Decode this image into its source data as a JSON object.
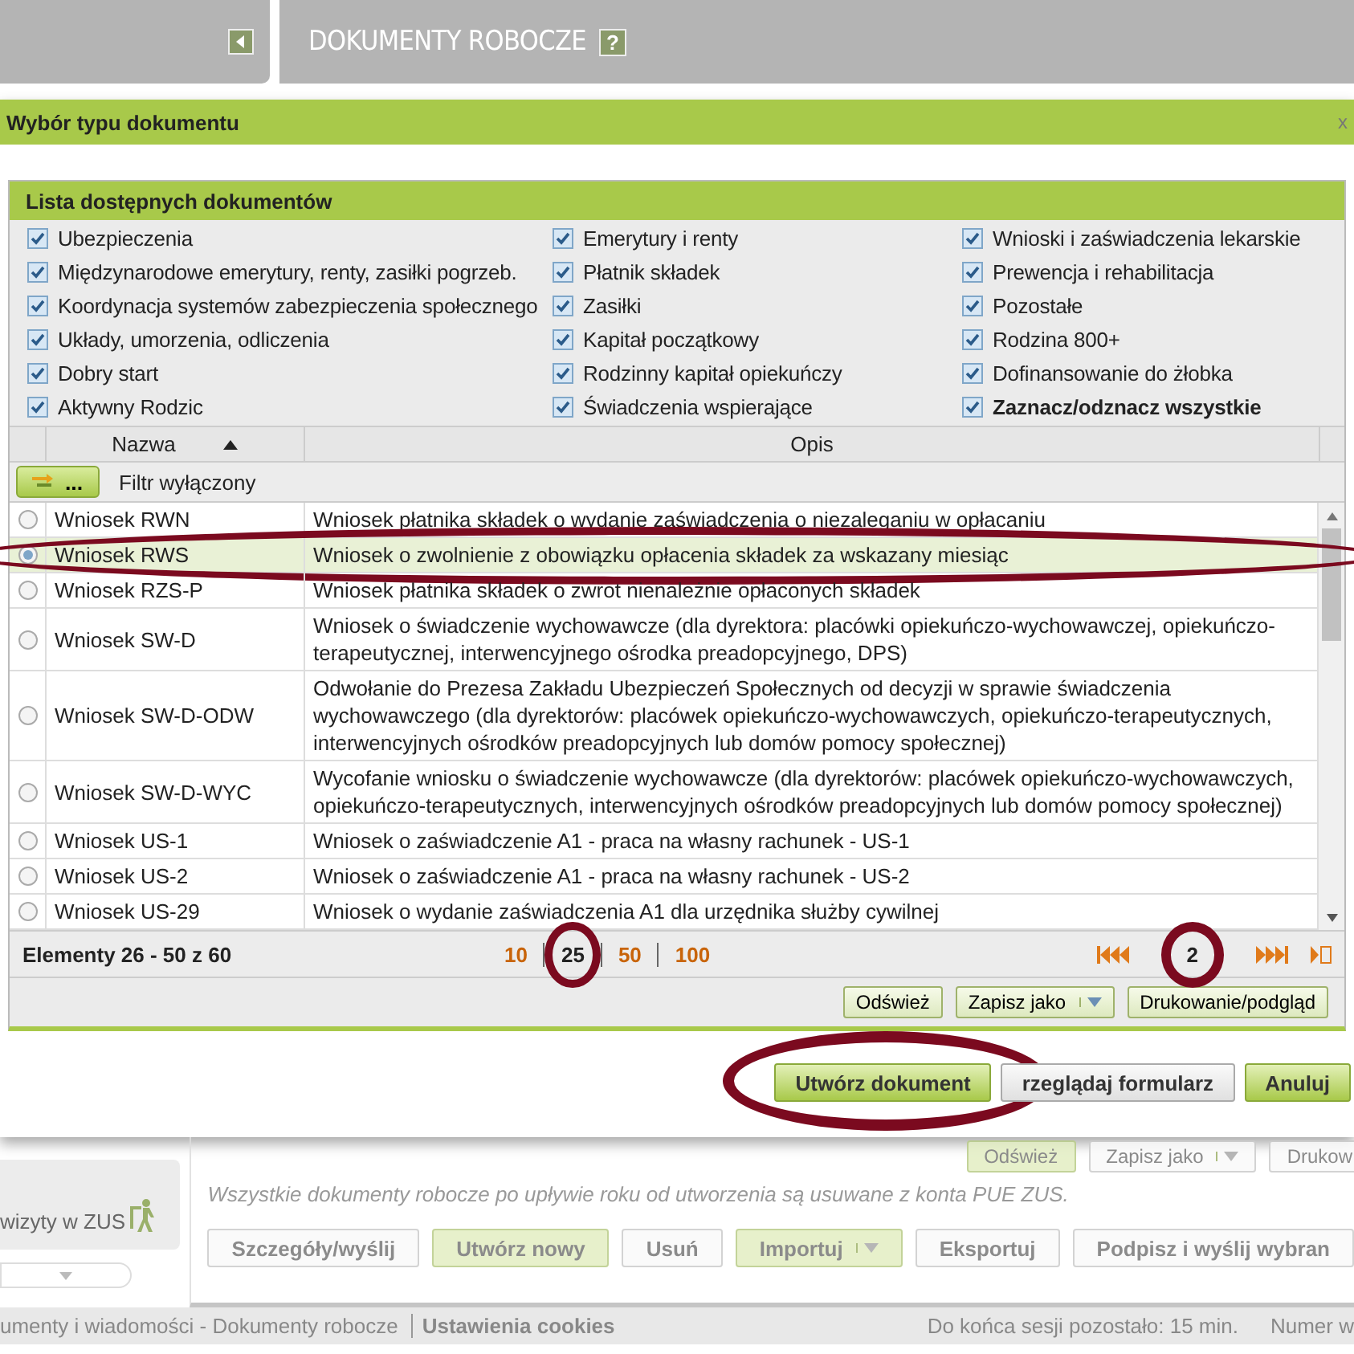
{
  "header": {
    "title": "DOKUMENTY ROBOCZE",
    "help": "?"
  },
  "dialog": {
    "title": "Wybór typu dokumentu",
    "close": "x",
    "panel_title": "Lista dostępnych dokumentów",
    "categories": [
      {
        "label": "Ubezpieczenia",
        "checked": true,
        "kind": "category"
      },
      {
        "label": "Emerytury i renty",
        "checked": true,
        "kind": "category"
      },
      {
        "label": "Wnioski i zaświadczenia lekarskie",
        "checked": true,
        "kind": "category"
      },
      {
        "label": "Międzynarodowe emerytury, renty, zasiłki pogrzeb.",
        "checked": true,
        "kind": "category"
      },
      {
        "label": "Płatnik składek",
        "checked": true,
        "kind": "category"
      },
      {
        "label": "Prewencja i rehabilitacja",
        "checked": true,
        "kind": "category"
      },
      {
        "label": "Koordynacja systemów zabezpieczenia społecznego",
        "checked": true,
        "kind": "category"
      },
      {
        "label": "Zasiłki",
        "checked": true,
        "kind": "category"
      },
      {
        "label": "Pozostałe",
        "checked": true,
        "kind": "category"
      },
      {
        "label": "Układy, umorzenia, odliczenia",
        "checked": true,
        "kind": "category"
      },
      {
        "label": "Kapitał początkowy",
        "checked": true,
        "kind": "category"
      },
      {
        "label": "Rodzina 800+",
        "checked": true,
        "kind": "category"
      },
      {
        "label": "Dobry start",
        "checked": true,
        "kind": "category"
      },
      {
        "label": "Rodzinny kapitał opiekuńczy",
        "checked": true,
        "kind": "category"
      },
      {
        "label": "Dofinansowanie do żłobka",
        "checked": true,
        "kind": "category"
      },
      {
        "label": "Aktywny Rodzic",
        "checked": true,
        "kind": "category"
      },
      {
        "label": "Świadczenia wspierające",
        "checked": true,
        "kind": "category"
      },
      {
        "label": "Zaznacz/odznacz wszystkie",
        "checked": true,
        "kind": "toggle_all"
      }
    ],
    "table": {
      "columns": [
        {
          "label": "Nazwa",
          "sorted": true
        },
        {
          "label": "Opis"
        }
      ],
      "filter": {
        "button": "...",
        "label": "Filtr wyłączony"
      },
      "rows": [
        {
          "name": "Wniosek RWN",
          "description": "Wniosek płatnika składek o wydanie zaświadczenia o niezaleganiu w opłacaniu",
          "selected": false,
          "highlighted": false
        },
        {
          "name": "Wniosek RWS",
          "description": "Wniosek o zwolnienie z obowiązku opłacenia składek za wskazany miesiąc",
          "selected": true,
          "highlighted": true
        },
        {
          "name": "Wniosek RZS-P",
          "description": "Wniosek płatnika składek o zwrot nienależnie opłaconych składek",
          "selected": false,
          "highlighted": false
        },
        {
          "name": "Wniosek SW-D",
          "description": "Wniosek o świadczenie wychowawcze (dla dyrektora: placówki opiekuńczo-wychowawczej, opiekuńczo-terapeutycznej, interwencyjnego ośrodka preadopcyjnego, DPS)",
          "selected": false,
          "highlighted": false
        },
        {
          "name": "Wniosek SW-D-ODW",
          "description": "Odwołanie do Prezesa Zakładu Ubezpieczeń Społecznych od decyzji w sprawie świadczenia wychowawczego (dla dyrektorów: placówek opiekuńczo-wychowawczych, opiekuńczo-terapeutycznych, interwencyjnych ośrodków preadopcyjnych lub domów pomocy społecznej)",
          "selected": false,
          "highlighted": false
        },
        {
          "name": "Wniosek SW-D-WYC",
          "description": "Wycofanie wniosku o świadczenie wychowawcze (dla dyrektorów: placówek opiekuńczo-wychowawczych, opiekuńczo-terapeutycznych, interwencyjnych ośrodków preadopcyjnych lub domów pomocy społecznej)",
          "selected": false,
          "highlighted": false
        },
        {
          "name": "Wniosek US-1",
          "description": "Wniosek o zaświadczenie A1 - praca na własny rachunek - US-1",
          "selected": false,
          "highlighted": false
        },
        {
          "name": "Wniosek US-2",
          "description": "Wniosek o zaświadczenie A1 - praca na własny rachunek - US-2",
          "selected": false,
          "highlighted": false
        },
        {
          "name": "Wniosek US-29",
          "description": "Wniosek o wydanie zaświadczenia A1 dla urzędnika służby cywilnej",
          "selected": false,
          "highlighted": false
        }
      ]
    },
    "pager": {
      "summary": "Elementy 26 - 50 z 60",
      "page_sizes": [
        {
          "label": "10",
          "selected": false,
          "highlighted": false
        },
        {
          "label": "25",
          "selected": true,
          "highlighted": true
        },
        {
          "label": "50",
          "selected": false,
          "highlighted": false
        },
        {
          "label": "100",
          "selected": false,
          "highlighted": false
        }
      ],
      "current_page": {
        "label": "2",
        "highlighted": true
      }
    },
    "toolbar": [
      {
        "label": "Odśwież",
        "kind": "button"
      },
      {
        "label": "Zapisz jako",
        "kind": "split"
      },
      {
        "label": "Drukowanie/podgląd",
        "kind": "button"
      }
    ],
    "buttons": [
      {
        "label": "Utwórz dokument",
        "kind": "primary",
        "highlighted": true
      },
      {
        "label": "rzeglądaj formularz",
        "kind": "secondary",
        "highlighted": false
      },
      {
        "label": "Anuluj",
        "kind": "primary",
        "highlighted": false
      }
    ]
  },
  "background": {
    "sidebar_item": "wizyty w ZUS",
    "toolbar": [
      {
        "label": "Odśwież",
        "kind": "primary"
      },
      {
        "label": "Zapisz jako",
        "kind": "split"
      },
      {
        "label": "Drukow",
        "kind": "secondary"
      }
    ],
    "note": "Wszystkie dokumenty robocze po upływie roku od utworzenia są usuwane z konta PUE ZUS.",
    "actions": [
      {
        "label": "Szczegóły/wyślij",
        "kind": "secondary"
      },
      {
        "label": "Utwórz nowy",
        "kind": "primary"
      },
      {
        "label": "Usuń",
        "kind": "secondary"
      },
      {
        "label": "Importuj",
        "kind": "split"
      },
      {
        "label": "Eksportuj",
        "kind": "secondary"
      },
      {
        "label": "Podpisz i wyślij wybran",
        "kind": "secondary"
      }
    ]
  },
  "status_bar": {
    "breadcrumb": "umenty i wiadomości - Dokumenty robocze",
    "cookies": "Ustawienia cookies",
    "session": "Do końca sesji pozostało: 15 min.",
    "number": "Numer w"
  }
}
